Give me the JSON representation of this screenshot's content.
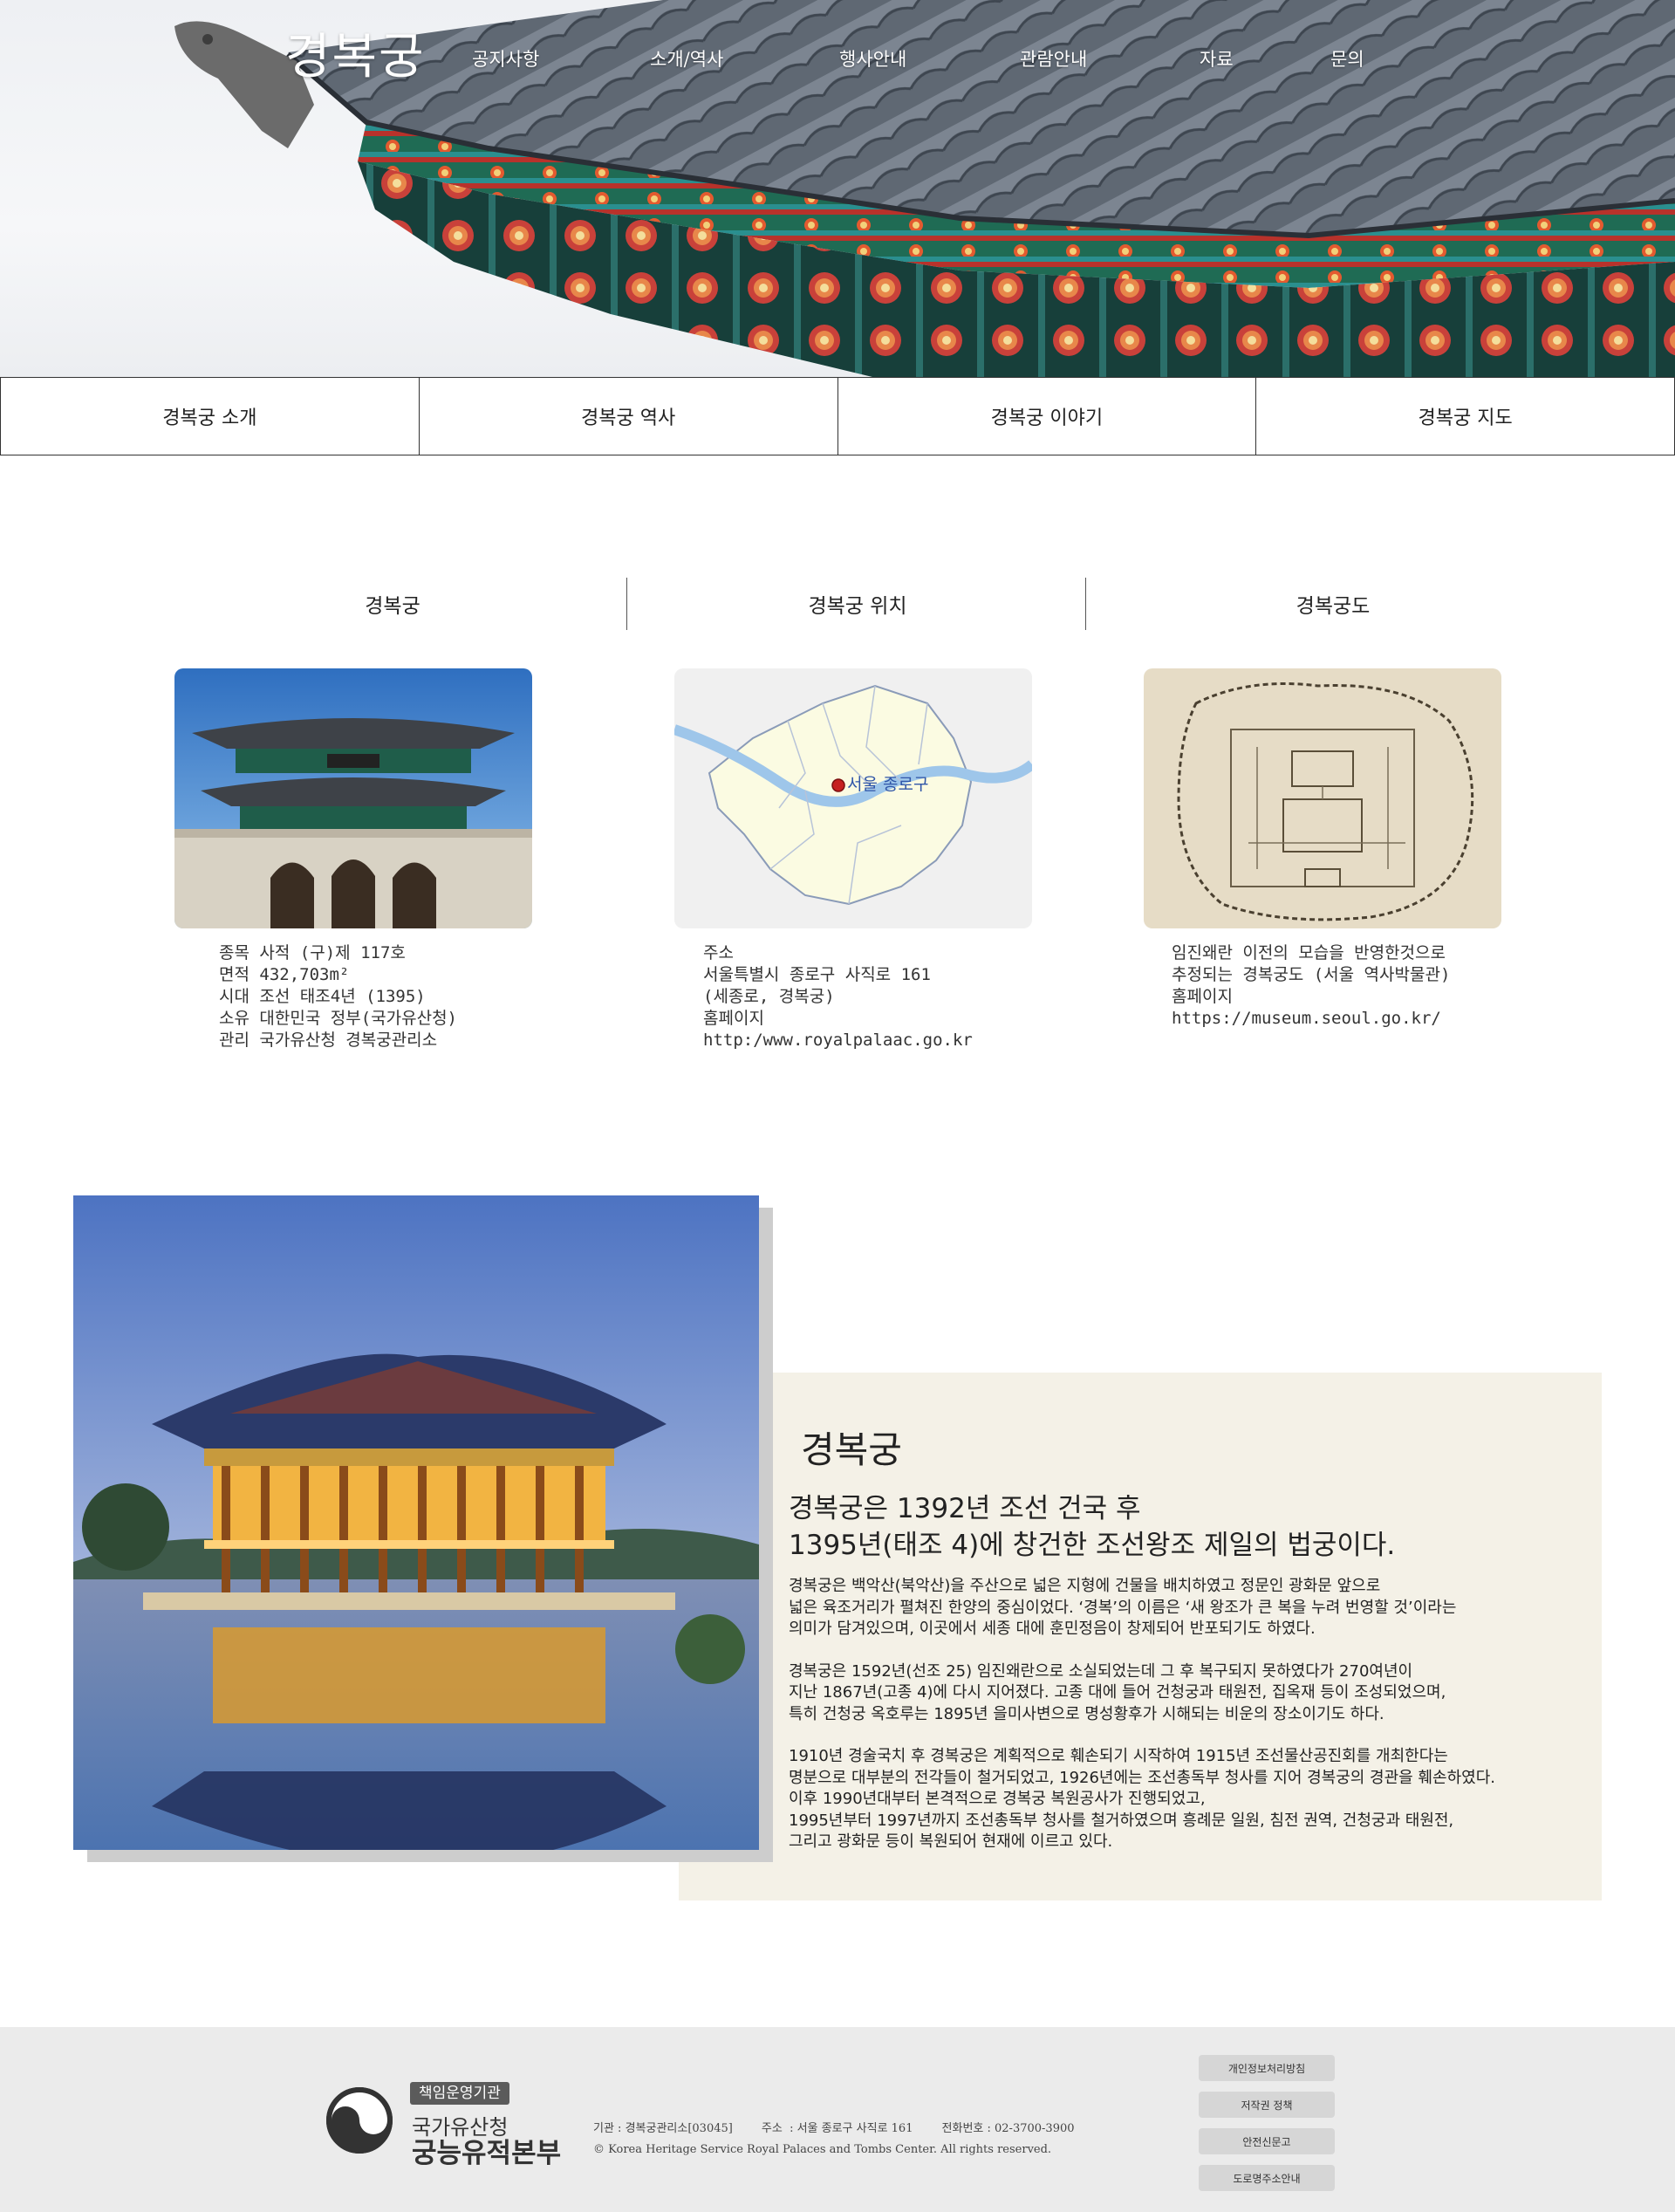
{
  "header": {
    "logo": "경복궁",
    "nav": [
      "공지사항",
      "소개/역사",
      "행사안내",
      "관람안내",
      "자료",
      "문의"
    ]
  },
  "subnav": {
    "tabs": [
      "경복궁 소개",
      "경복궁 역사",
      "경복궁 이야기",
      "경복궁 지도"
    ]
  },
  "info": {
    "tabs": [
      "경복궁",
      "경복궁 위치",
      "경복궁도"
    ],
    "cards": [
      {
        "lines": [
          "종목 사적 (구)제 117호",
          "면적 432,703m²",
          "시대 조선 태조4년 (1395)",
          "소유 대한민국 정부(국가유산청)",
          "관리 국가유산청 경복궁관리소"
        ]
      },
      {
        "map_label": "서울 종로구",
        "lines": [
          "주소",
          "서울특별시 종로구 사직로 161",
          "(세종로, 경복궁)",
          "홈페이지",
          "http:/www.royalpalaac.go.kr"
        ]
      },
      {
        "lines": [
          "임진왜란 이전의 모습을 반영한것으로",
          "추정되는 경복궁도 (서울 역사박물관)",
          "홈페이지",
          "https://museum.seoul.go.kr/"
        ]
      }
    ]
  },
  "feature": {
    "title": "경복궁",
    "lead": [
      "경복궁은 1392년 조선 건국 후",
      "1395년(태조 4)에 창건한 조선왕조 제일의 법궁이다."
    ],
    "paragraphs": [
      "경복궁은 백악산(북악산)을 주산으로 넓은 지형에 건물을 배치하였고 정문인 광화문 앞으로\n넓은 육조거리가 펼쳐진 한양의 중심이었다. ‘경복’의 이름은 ‘새 왕조가 큰 복을 누려 번영할 것’이라는\n의미가 담겨있으며, 이곳에서 세종 대에 훈민정음이 창제되어 반포되기도 하였다.",
      "경복궁은 1592년(선조 25) 임진왜란으로 소실되었는데 그 후 복구되지 못하였다가 270여년이\n지난 1867년(고종 4)에 다시 지어졌다. 고종 대에 들어 건청궁과 태원전, 집옥재 등이 조성되었으며,\n특히 건청궁 옥호루는 1895년 을미사변으로 명성황후가 시해되는 비운의 장소이기도 하다.",
      "1910년 경술국치 후 경복궁은 계획적으로 훼손되기 시작하여 1915년 조선물산공진회를 개최한다는\n명분으로 대부분의 전각들이 철거되었고, 1926년에는 조선총독부 청사를 지어 경복궁의 경관을 훼손하였다.\n이후 1990년대부터 본격적으로 경복궁 복원공사가 진행되었고,\n1995년부터 1997년까지 조선총독부 청사를 철거하였으며 흥례문 일원, 침전 권역, 건청궁과 태원전,\n그리고 광화문 등이 복원되어 현재에 이르고 있다."
    ]
  },
  "footer": {
    "badge": "책임운영기관",
    "org_line1": "국가유산청",
    "org_line2": "궁능유적본부",
    "info_line": "기관 : 경복궁관리소[03045]        주소  : 서울 종로구 사직로 161        전화번호 : 02-3700-3900",
    "copyright": "© Korea Heritage Service Royal Palaces and Tombs Center. All rights reserved.",
    "links": [
      "개인정보처리방침",
      "저작권 정책",
      "안전신문고",
      "도로명주소안내"
    ]
  },
  "colors": {
    "feature_box": "#f4f1e7",
    "footer_bg": "#ebebeb",
    "footer_button": "#d6d6d6"
  }
}
